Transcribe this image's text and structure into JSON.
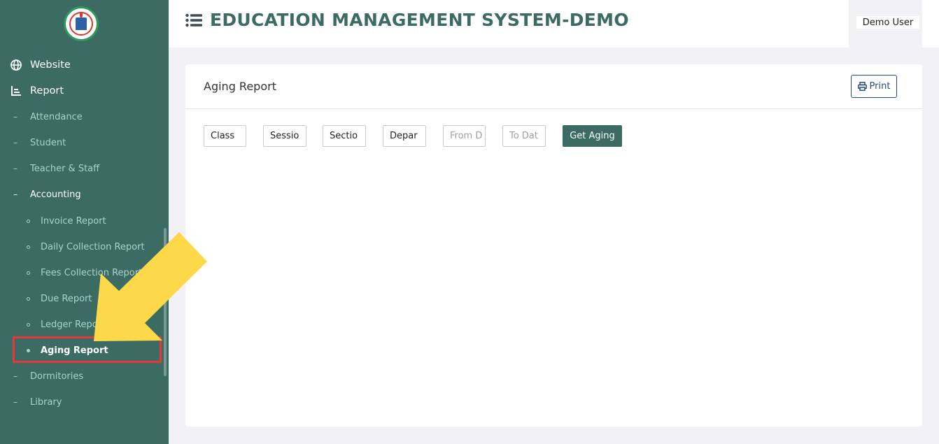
{
  "header": {
    "title": "EDUCATION MANAGEMENT SYSTEM-DEMO",
    "user_name": "Demo User"
  },
  "sidebar": {
    "top_items": [
      {
        "label": "Website",
        "icon": "globe-icon"
      },
      {
        "label": "Report",
        "icon": "chart-icon"
      }
    ],
    "report_items": [
      {
        "label": "Attendance"
      },
      {
        "label": "Student"
      },
      {
        "label": "Teacher & Staff"
      },
      {
        "label": "Accounting"
      }
    ],
    "accounting_items": [
      {
        "label": "Invoice Report"
      },
      {
        "label": "Daily Collection Report"
      },
      {
        "label": "Fees Collection Report"
      },
      {
        "label": "Due Report"
      },
      {
        "label": "Ledger Report"
      },
      {
        "label": "Aging Report"
      }
    ],
    "bottom_items": [
      {
        "label": "Dormitories"
      },
      {
        "label": "Library"
      }
    ]
  },
  "card": {
    "title": "Aging Report",
    "print_label": "Print"
  },
  "filters": {
    "class_label": "Class",
    "session_label": "Sessio",
    "section_label": "Sectio",
    "department_label": "Depar",
    "from_date_placeholder": "From D",
    "to_date_placeholder": "To Dat",
    "get_button_label": "Get Aging"
  },
  "colors": {
    "sidebar_bg": "#3c6b63",
    "accent": "#3c6b63",
    "highlight": "#e53935",
    "arrow": "#fdd94a"
  }
}
